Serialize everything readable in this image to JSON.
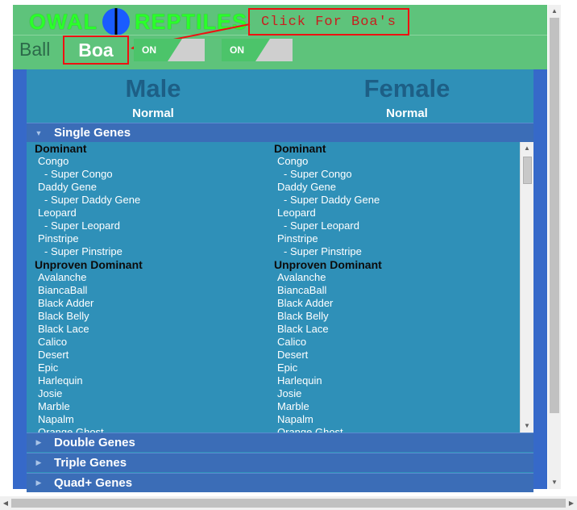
{
  "logo": {
    "left_word": "OWAL",
    "right_word": "REPTILES"
  },
  "callout": "Click For Boa's",
  "species": {
    "ball": "Ball",
    "boa": "Boa"
  },
  "toggles": [
    {
      "label": "ON"
    },
    {
      "label": "ON"
    }
  ],
  "main": {
    "male": {
      "title": "Male",
      "subtitle": "Normal"
    },
    "female": {
      "title": "Female",
      "subtitle": "Normal"
    }
  },
  "sections": {
    "single": {
      "label": "Single Genes",
      "caret": "▼"
    },
    "double": {
      "label": "Double Genes",
      "caret": "▶"
    },
    "triple": {
      "label": "Triple Genes",
      "caret": "▶"
    },
    "quad": {
      "label": "Quad+ Genes",
      "caret": "▶"
    }
  },
  "genes": {
    "dominant_label": "Dominant",
    "dominant": [
      "Congo",
      "- Super Congo",
      "Daddy Gene",
      "- Super Daddy Gene",
      "Leopard",
      "- Super Leopard",
      "Pinstripe",
      "- Super Pinstripe"
    ],
    "unproven_label": "Unproven Dominant",
    "unproven": [
      "Avalanche",
      "BiancaBall",
      "Black Adder",
      "Black Belly",
      "Black Lace",
      "Calico",
      "Desert",
      "Epic",
      "Harlequin",
      "Josie",
      "Marble",
      "Napalm",
      "Orange Ghost"
    ]
  },
  "colors": {
    "header_green": "#5ec37b",
    "panel_blue": "#2f90b8",
    "accordion_blue": "#3b6db7",
    "callout_red": "#c81e1e"
  }
}
